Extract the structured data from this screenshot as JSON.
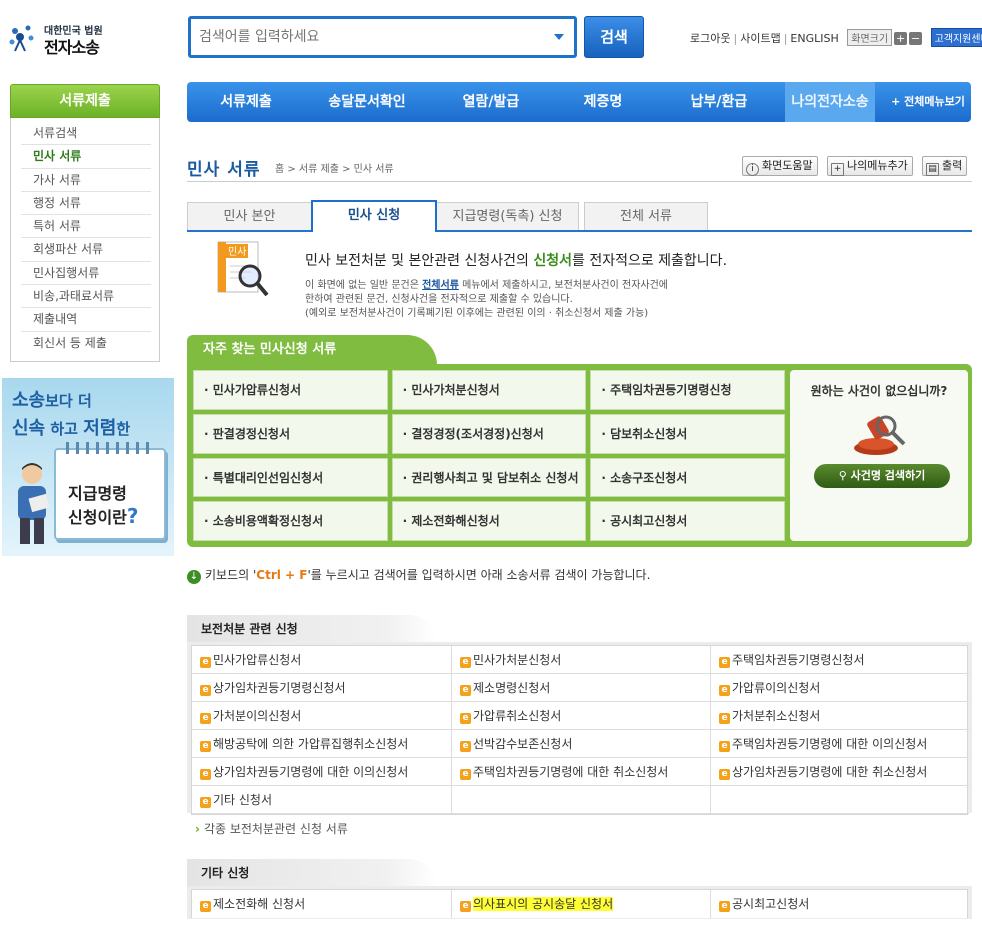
{
  "header": {
    "logo_line1": "대한민국 법원",
    "logo_line2": "전자소송",
    "search_placeholder": "검색어를 입력하세요",
    "search_button": "검색",
    "util": [
      "로그아웃",
      "사이트맵",
      "ENGLISH"
    ],
    "font_size_label": "화면크기",
    "font_plus": "+",
    "font_minus": "−",
    "helpdesk": "고객지원센터"
  },
  "nav": {
    "items": [
      "서류제출",
      "송달문서확인",
      "열람/발급",
      "제증명",
      "납부/환급",
      "나의전자소송"
    ],
    "all_menu": "+ 전체메뉴보기"
  },
  "sidebar": {
    "title": "서류제출",
    "items": [
      "서류검색",
      "민사 서류",
      "가사 서류",
      "행정 서류",
      "특허 서류",
      "회생파산 서류",
      "민사집행서류",
      "비송,과태료서류",
      "제출내역",
      "회신서 등 제출"
    ],
    "active_index": 1
  },
  "banner": {
    "line1_big": "소송",
    "line1_rest": "보다 더",
    "line2_a": "신속",
    "line2_b": "하고",
    "line2_c": "저렴",
    "line2_d": "한",
    "card_line1": "지급명령",
    "card_line2": "신청이란",
    "card_q": "?"
  },
  "page": {
    "title": "민사 서류",
    "breadcrumb": "홈 > 서류 제출 > 민사 서류",
    "buttons": {
      "help": "화면도움말",
      "add_menu": "나의메뉴추가",
      "print": "출력"
    }
  },
  "tabs": [
    "민사 본안",
    "민사 신청",
    "지급명령(독촉) 신청",
    "전체 서류"
  ],
  "active_tab": 1,
  "intro": {
    "icon_label": "민사",
    "head_pre": "민사 보전처분 및 본안관련 신청사건의 ",
    "head_hl": "신청서",
    "head_post": "를 전자적으로 제출합니다.",
    "body_pre": "이 화면에 없는 일반 문건은 ",
    "body_link": "전체서류",
    "body_post": " 메뉴에서 제출하시고, 보전처분사건이 전자사건에",
    "body_line2": "한하여 관련된 문건, 신청사건을 전자적으로 제출할 수 있습니다.",
    "body_line3": "(예외로 보전처분사건이 기록폐기된 이후에는 관련된 이의 · 취소신청서 제출 가능)"
  },
  "faq": {
    "title": "자주 찾는 민사신청 서류",
    "items": [
      "· 민사가압류신청서",
      "· 민사가처분신청서",
      "· 주택임차권등기명령신청",
      "· 판결경정신청서",
      "· 결정경정(조서경정)신청서",
      "· 담보취소신청서",
      "· 특별대리인선임신청서",
      "· 권리행사최고 및 담보취소 신청서",
      "· 소송구조신청서",
      "· 소송비용액확정신청서",
      "· 제소전화해신청서",
      "· 공시최고신청서"
    ],
    "side_question": "원하는 사건이 없으십니까?",
    "side_button": "사건명 검색하기"
  },
  "hint": {
    "pre": "키보드의 '",
    "key": "Ctrl + F",
    "post": "'를 누르시고 검색어를 입력하시면 아래 소송서류 검색이 가능합니다."
  },
  "section1": {
    "title": "보전처분 관련 신청",
    "items": [
      "민사가압류신청서",
      "민사가처분신청서",
      "주택임차권등기명령신청서",
      "상가임차권등기명령신청서",
      "제소명령신청서",
      "가압류이의신청서",
      "가처분이의신청서",
      "가압류취소신청서",
      "가처분취소신청서",
      "해방공탁에 의한 가압류집행취소신청서",
      "선박감수보존신청서",
      "주택임차권등기명령에 대한 이의신청서",
      "상가임차권등기명령에 대한 이의신청서",
      "주택임차권등기명령에 대한 취소신청서",
      "상가임차권등기명령에 대한 취소신청서",
      "기타 신청서"
    ],
    "more_link": "각종 보전처분관련 신청 서류"
  },
  "section2": {
    "title": "기타 신청",
    "items": [
      "제소전화해 신청서",
      "의사표시의 공시송달 신청서",
      "공시최고신청서"
    ],
    "highlight_index": 1
  },
  "colors": {
    "nav_blue": "#1b6ccd",
    "green": "#7fbc40",
    "highlight": "#ffff33",
    "e_icon": "#f4a21c"
  }
}
